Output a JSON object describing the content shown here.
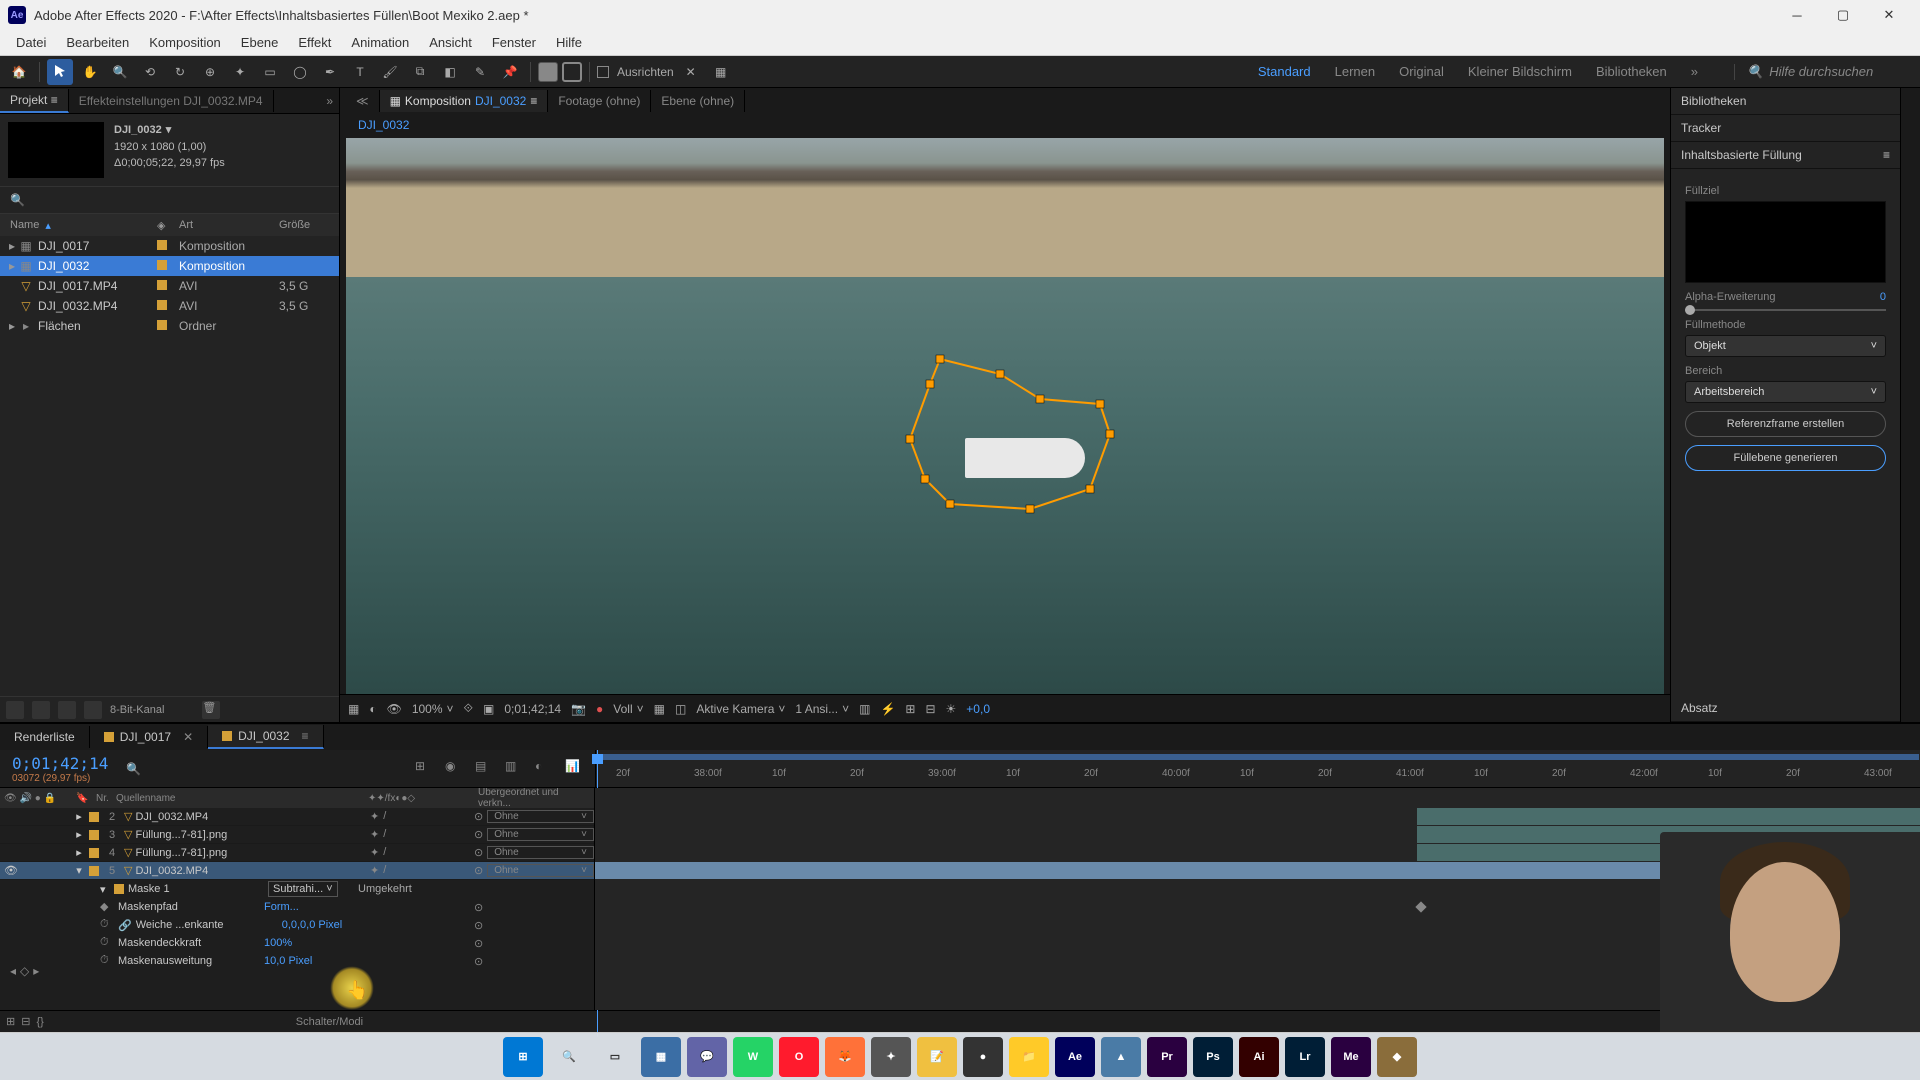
{
  "titlebar": {
    "app_icon": "Ae",
    "title": "Adobe After Effects 2020 - F:\\After Effects\\Inhaltsbasiertes Füllen\\Boot Mexiko 2.aep *"
  },
  "menubar": [
    "Datei",
    "Bearbeiten",
    "Komposition",
    "Ebene",
    "Effekt",
    "Animation",
    "Ansicht",
    "Fenster",
    "Hilfe"
  ],
  "toolbar": {
    "align_label": "Ausrichten",
    "workspaces": [
      "Standard",
      "Lernen",
      "Original",
      "Kleiner Bildschirm",
      "Bibliotheken"
    ],
    "active_workspace": "Standard",
    "search_placeholder": "Hilfe durchsuchen"
  },
  "project_panel": {
    "tab_project": "Projekt",
    "tab_effects": "Effekteinstellungen DJI_0032.MP4",
    "meta": {
      "name": "DJI_0032",
      "res": "1920 x 1080 (1,00)",
      "dur": "Δ0;00;05;22, 29,97 fps"
    },
    "cols": {
      "name": "Name",
      "type": "Art",
      "size": "Größe"
    },
    "items": [
      {
        "name": "DJI_0017",
        "type": "Komposition",
        "size": "",
        "color": "#d4a038",
        "icon": "comp",
        "exp": true
      },
      {
        "name": "DJI_0032",
        "type": "Komposition",
        "size": "",
        "color": "#d4a038",
        "icon": "comp",
        "exp": true,
        "selected": true
      },
      {
        "name": "DJI_0017.MP4",
        "type": "AVI",
        "size": "3,5 G",
        "color": "#d4a038",
        "icon": "video"
      },
      {
        "name": "DJI_0032.MP4",
        "type": "AVI",
        "size": "3,5 G",
        "color": "#d4a038",
        "icon": "video"
      },
      {
        "name": "Flächen",
        "type": "Ordner",
        "size": "",
        "color": "#d4a038",
        "icon": "folder",
        "exp": true
      }
    ],
    "footer_depth": "8-Bit-Kanal"
  },
  "viewer": {
    "tab_comp_prefix": "Komposition",
    "tab_comp_name": "DJI_0032",
    "tab_footage": "Footage (ohne)",
    "tab_layer": "Ebene (ohne)",
    "path": "DJI_0032",
    "footer": {
      "zoom": "100%",
      "timecode": "0;01;42;14",
      "res": "Voll",
      "camera": "Aktive Kamera",
      "views": "1 Ansi...",
      "exposure": "+0,0"
    }
  },
  "right": {
    "libs": "Bibliotheken",
    "tracker": "Tracker",
    "caf": "Inhaltsbasierte Füllung",
    "fill_target": "Füllziel",
    "alpha_exp": "Alpha-Erweiterung",
    "alpha_val": "0",
    "fill_method": "Füllmethode",
    "fill_method_val": "Objekt",
    "range": "Bereich",
    "range_val": "Arbeitsbereich",
    "btn_ref": "Referenzframe erstellen",
    "btn_gen": "Füllebene generieren",
    "absatz": "Absatz"
  },
  "timeline": {
    "tab_render": "Renderliste",
    "tabs": [
      {
        "label": "DJI_0017",
        "color": "#d4a038"
      },
      {
        "label": "DJI_0032",
        "color": "#d4a038",
        "active": true
      }
    ],
    "timecode": "0;01;42;14",
    "timecode_sub": "03072 (29,97 fps)",
    "col_nr": "Nr.",
    "col_src": "Quellenname",
    "col_parent": "Übergeordnet und verkn...",
    "ruler_ticks": [
      "20f",
      "38:00f",
      "10f",
      "20f",
      "39:00f",
      "10f",
      "20f",
      "40:00f",
      "10f",
      "20f",
      "41:00f",
      "10f",
      "20f",
      "42:00f",
      "10f",
      "20f",
      "43:00f"
    ],
    "layers": [
      {
        "num": "2",
        "name": "DJI_0032.MP4",
        "color": "#d4a038",
        "parent": "Ohne",
        "track_start": 62
      },
      {
        "num": "3",
        "name": "Füllung...7-81].png",
        "color": "#d4a038",
        "parent": "Ohne",
        "track_start": 62
      },
      {
        "num": "4",
        "name": "Füllung...7-81].png",
        "color": "#d4a038",
        "parent": "Ohne",
        "track_start": 62
      },
      {
        "num": "5",
        "name": "DJI_0032.MP4",
        "color": "#d4a038",
        "parent": "Ohne",
        "selected": true,
        "open": true,
        "track_start": 0
      }
    ],
    "mask": {
      "name": "Maske 1",
      "mode": "Subtrahi...",
      "invert": "Umgekehrt",
      "props": [
        {
          "label": "Maskenpfad",
          "value": "Form...",
          "kf": true
        },
        {
          "label": "Weiche ...enkante",
          "value": "0,0,0,0 Pixel",
          "link": true
        },
        {
          "label": "Maskendeckkraft",
          "value": "100%"
        },
        {
          "label": "Maskenausweitung",
          "value": "10,0 Pixel"
        }
      ]
    },
    "footer_switches": "Schalter/Modi"
  },
  "taskbar": {
    "icons": [
      {
        "name": "windows",
        "bg": "#0078d4",
        "glyph": "⊞"
      },
      {
        "name": "search",
        "bg": "transparent",
        "glyph": "🔍"
      },
      {
        "name": "task-view",
        "bg": "transparent",
        "glyph": "▭"
      },
      {
        "name": "widgets",
        "bg": "#3b6ea5",
        "glyph": "▦"
      },
      {
        "name": "teams",
        "bg": "#6264a7",
        "glyph": "💬"
      },
      {
        "name": "whatsapp",
        "bg": "#25d366",
        "glyph": "W"
      },
      {
        "name": "opera",
        "bg": "#ff1b2d",
        "glyph": "O"
      },
      {
        "name": "firefox",
        "bg": "#ff7139",
        "glyph": "🦊"
      },
      {
        "name": "app1",
        "bg": "#555",
        "glyph": "✦"
      },
      {
        "name": "notes",
        "bg": "#f0c040",
        "glyph": "📝"
      },
      {
        "name": "obs",
        "bg": "#333",
        "glyph": "●"
      },
      {
        "name": "explorer",
        "bg": "#ffca28",
        "glyph": "📁"
      },
      {
        "name": "ae",
        "bg": "#00005b",
        "glyph": "Ae"
      },
      {
        "name": "me-alt",
        "bg": "#4a7ba6",
        "glyph": "▲"
      },
      {
        "name": "pr",
        "bg": "#2a0040",
        "glyph": "Pr"
      },
      {
        "name": "ps",
        "bg": "#001e36",
        "glyph": "Ps"
      },
      {
        "name": "ai",
        "bg": "#330000",
        "glyph": "Ai"
      },
      {
        "name": "lr",
        "bg": "#001e36",
        "glyph": "Lr"
      },
      {
        "name": "me",
        "bg": "#2a0040",
        "glyph": "Me"
      },
      {
        "name": "misc",
        "bg": "#8a6d3b",
        "glyph": "◆"
      }
    ]
  }
}
